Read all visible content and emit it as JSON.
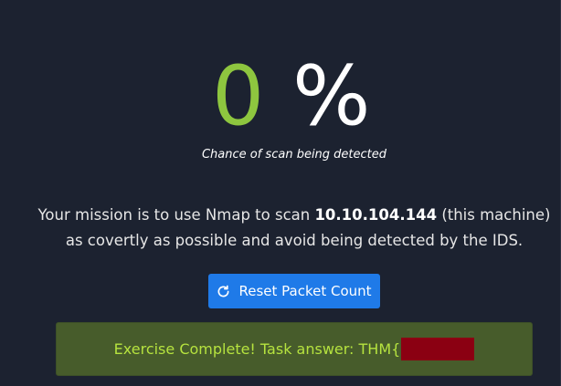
{
  "detection": {
    "value": "0",
    "sign": "%",
    "caption": "Chance of scan being detected",
    "value_color": "#8ec63f"
  },
  "mission": {
    "line1_prefix": "Your mission is to use Nmap to scan ",
    "target_ip": "10.10.104.144",
    "line1_suffix": " (this machine)",
    "line2": "as covertly as possible and avoid being detected by the IDS."
  },
  "reset_button": {
    "label": "Reset Packet Count",
    "icon": "refresh-icon",
    "color": "#1f7ae8"
  },
  "result": {
    "text": "Exercise Complete! Task answer: THM{",
    "redacted": true,
    "banner_color": "#475c2b",
    "text_color": "#b6e33f"
  }
}
